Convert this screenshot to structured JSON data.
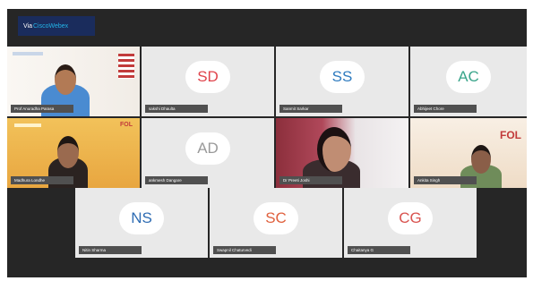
{
  "app_badge": {
    "prefix": "Via ",
    "brand": "CiscoWebex"
  },
  "participants": [
    {
      "name": "Prof Anuradha Parasa",
      "initials": "",
      "type": "video"
    },
    {
      "name": "sakshi Dhaulta",
      "initials": "SD",
      "color": "#e0434b",
      "type": "avatar"
    },
    {
      "name": "Sanmit Sarkar",
      "initials": "SS",
      "color": "#2e7bbf",
      "type": "avatar"
    },
    {
      "name": "Abhijeet Chore",
      "initials": "AC",
      "color": "#3aa58b",
      "type": "avatar"
    },
    {
      "name": "Madhura Londhe",
      "initials": "",
      "type": "video"
    },
    {
      "name": "ankmesh Dangare",
      "initials": "AD",
      "color": "#9a9a9a",
      "type": "avatar"
    },
    {
      "name": "Dr Preeti Joshi",
      "initials": "",
      "type": "video"
    },
    {
      "name": "Ankita Singh",
      "initials": "",
      "type": "video"
    },
    {
      "name": "Nitin Sharma",
      "initials": "NS",
      "color": "#2e6cb3",
      "type": "avatar"
    },
    {
      "name": "Swapnil Chaturvedi",
      "initials": "SC",
      "color": "#e0613e",
      "type": "avatar"
    },
    {
      "name": "Chaitanya G",
      "initials": "CG",
      "color": "#d9534f",
      "type": "avatar"
    }
  ],
  "logos": {
    "fol": "FOL"
  }
}
